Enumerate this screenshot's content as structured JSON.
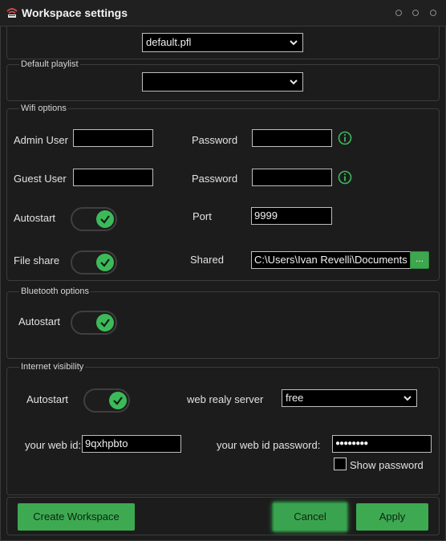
{
  "window": {
    "title": "Workspace settings"
  },
  "profile": {
    "selected": "default.pfl"
  },
  "default_playlist": {
    "legend": "Default playlist",
    "selected": ""
  },
  "wifi": {
    "legend": "Wifi options",
    "admin_user_label": "Admin User",
    "admin_user_value": "",
    "admin_password_label": "Password",
    "admin_password_value": "",
    "guest_user_label": "Guest User",
    "guest_user_value": "",
    "guest_password_label": "Password",
    "guest_password_value": "",
    "autostart_label": "Autostart",
    "autostart_on": true,
    "port_label": "Port",
    "port_value": "9999",
    "file_share_label": "File share",
    "file_share_on": true,
    "shared_label": "Shared",
    "shared_path": "C:\\Users\\Ivan Revelli\\Documents",
    "browse_label": "..."
  },
  "bluetooth": {
    "legend": "Bluetooth options",
    "autostart_label": "Autostart",
    "autostart_on": true
  },
  "internet": {
    "legend": "Internet visibility",
    "autostart_label": "Autostart",
    "autostart_on": true,
    "server_label": "web realy server",
    "server_selected": "free",
    "web_id_label": "your web id:",
    "web_id_value": "9qxhpbto",
    "password_label": "your web id password:",
    "password_value": "●●●●●●●●",
    "show_password_label": "Show password",
    "show_password_checked": false
  },
  "buttons": {
    "create": "Create Workspace",
    "cancel": "Cancel",
    "apply": "Apply"
  },
  "colors": {
    "accent": "#3daa52",
    "background": "#1c1c1c",
    "titlebar": "#202020"
  },
  "icons": {
    "app": "signal-icon",
    "info": "info-icon",
    "dropdown": "chevron-down-icon",
    "toggle": "checkmark-icon"
  }
}
